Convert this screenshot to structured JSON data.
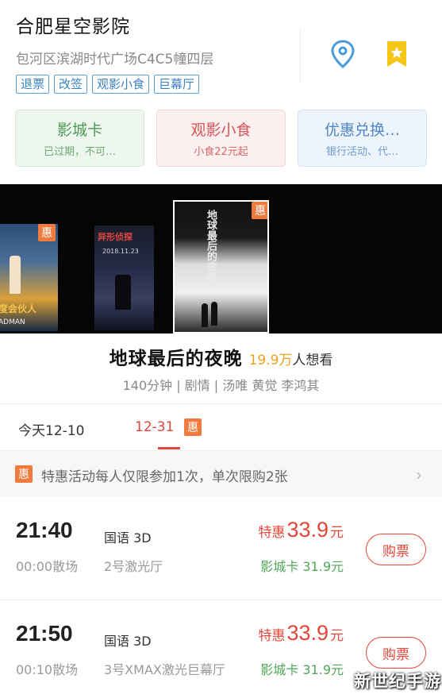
{
  "cinema": {
    "name": "合肥星空影院",
    "address": "包河区滨湖时代广场C4C5幢四层",
    "tags": [
      "退票",
      "改签",
      "观影小食",
      "巨幕厅"
    ]
  },
  "cards": [
    {
      "title": "影城卡",
      "subtitle": "已过期，不可…"
    },
    {
      "title": "观影小食",
      "subtitle": "小食22元起"
    },
    {
      "title": "优惠兑换…",
      "subtitle": "银行活动、代…"
    }
  ],
  "posters": {
    "badge": "惠",
    "left_caption": "度会伙人",
    "left_caption_sub": "ADMAN",
    "mid_title": "异形侦探",
    "mid_date": "2018.11.23",
    "main_title": "地球最后的夜晚"
  },
  "movie": {
    "title": "地球最后的夜晚",
    "want_count": "19.9万",
    "want_suffix": "人想看",
    "meta": "140分钟 | 剧情 | 汤唯 黄觉 李鸿其"
  },
  "date_tabs": {
    "today": "今天12-10",
    "selected": "12-31",
    "badge": "惠"
  },
  "notice": {
    "badge": "惠",
    "text": "特惠活动每人仅限参加1次，单次限购2张",
    "chevron": "›"
  },
  "showtimes": [
    {
      "start": "21:40",
      "end": "00:00散场",
      "language": "国语 3D",
      "hall": "2号激光厅",
      "price_label": "特惠",
      "price": "33.9",
      "price_unit": "元",
      "member_price": "影城卡 31.9元",
      "button": "购票"
    },
    {
      "start": "21:50",
      "end": "00:10散场",
      "language": "国语 3D",
      "hall": "3号XMAX激光巨幕厅",
      "price_label": "特惠",
      "price": "33.9",
      "price_unit": "元",
      "member_price": "影城卡 31.9元",
      "button": "购票"
    }
  ],
  "watermark": "新世纪手游",
  "icons": {
    "location": "location-pin-icon",
    "favorite": "bookmark-star-icon"
  },
  "colors": {
    "accent_red": "#e2473a",
    "tag_blue": "#3b82c4",
    "member_green": "#4fa858",
    "badge_orange": "#f07b3f"
  }
}
